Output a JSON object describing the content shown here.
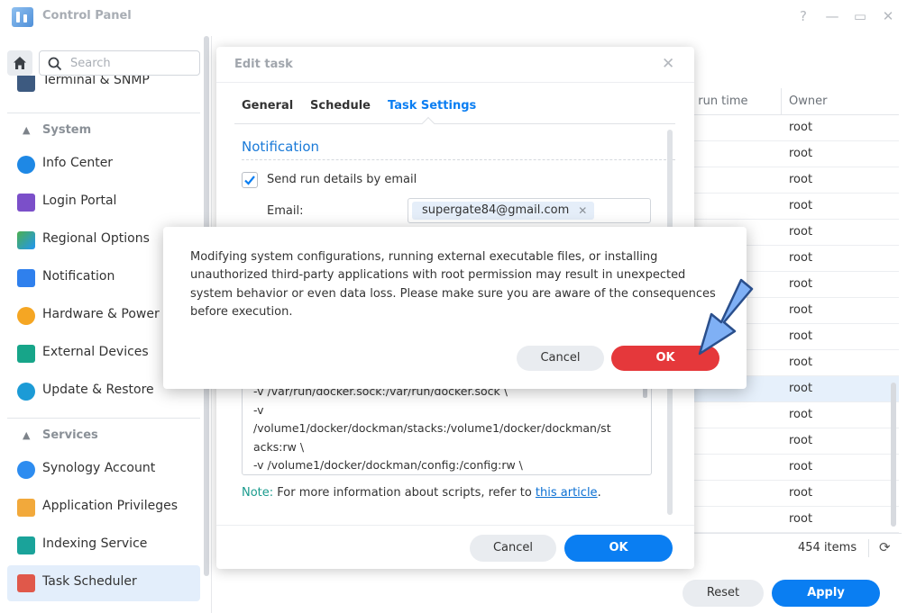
{
  "window": {
    "title": "Control Panel",
    "controls": [
      "?",
      "—",
      "▭",
      "✕"
    ]
  },
  "sidebar": {
    "search_placeholder": "Search",
    "partial_item": "Terminal & SNMP",
    "sections": [
      {
        "title": "System",
        "items": [
          {
            "label": "Info Center",
            "icon": "info-icon"
          },
          {
            "label": "Login Portal",
            "icon": "login-portal-icon"
          },
          {
            "label": "Regional Options",
            "icon": "regional-options-icon"
          },
          {
            "label": "Notification",
            "icon": "notification-icon"
          },
          {
            "label": "Hardware & Power",
            "icon": "hardware-power-icon"
          },
          {
            "label": "External Devices",
            "icon": "external-devices-icon"
          },
          {
            "label": "Update & Restore",
            "icon": "update-restore-icon"
          }
        ]
      },
      {
        "title": "Services",
        "items": [
          {
            "label": "Synology Account",
            "icon": "synology-account-icon"
          },
          {
            "label": "Application Privileges",
            "icon": "application-privileges-icon"
          },
          {
            "label": "Indexing Service",
            "icon": "indexing-service-icon"
          },
          {
            "label": "Task Scheduler",
            "icon": "task-scheduler-icon",
            "active": true
          }
        ]
      }
    ]
  },
  "table": {
    "columns": [
      "t run time",
      "Owner"
    ],
    "rows": [
      "root",
      "root",
      "root",
      "root",
      "root",
      "root",
      "root",
      "root",
      "root",
      "root",
      "root",
      "root",
      "root",
      "root",
      "root",
      "root"
    ],
    "selected_row": 10,
    "item_count": "454 items"
  },
  "main_footer": {
    "reset_label": "Reset",
    "apply_label": "Apply"
  },
  "edit_task": {
    "title": "Edit task",
    "tabs": [
      "General",
      "Schedule",
      "Task Settings"
    ],
    "active_tab": "Task Settings",
    "section_title": "Notification",
    "send_email_label": "Send run details by email",
    "send_email_checked": true,
    "email_label": "Email:",
    "email_value": "supergate84@gmail.com",
    "script_lines": [
      "-v /var/run/docker.sock:/var/run/docker.sock \\",
      "-v",
      "/volume1/docker/dockman/stacks:/volume1/docker/dockman/st",
      "acks:rw \\",
      "-v /volume1/docker/dockman/config:/config:rw \\"
    ],
    "note_label": "Note:",
    "note_text": "For more information about scripts, refer to",
    "note_link": "this article",
    "note_end": ".",
    "cancel_label": "Cancel",
    "ok_label": "OK"
  },
  "warning": {
    "message": "Modifying system configurations, running external executable files, or installing unauthorized third-party applications with root permission may result in unexpected system behavior or even data loss. Please make sure you are aware of the consequences before execution.",
    "cancel_label": "Cancel",
    "ok_label": "OK"
  },
  "colors": {
    "accent": "#0a7ef2",
    "danger": "#e5383b",
    "arrow": "#7fb0f5"
  }
}
